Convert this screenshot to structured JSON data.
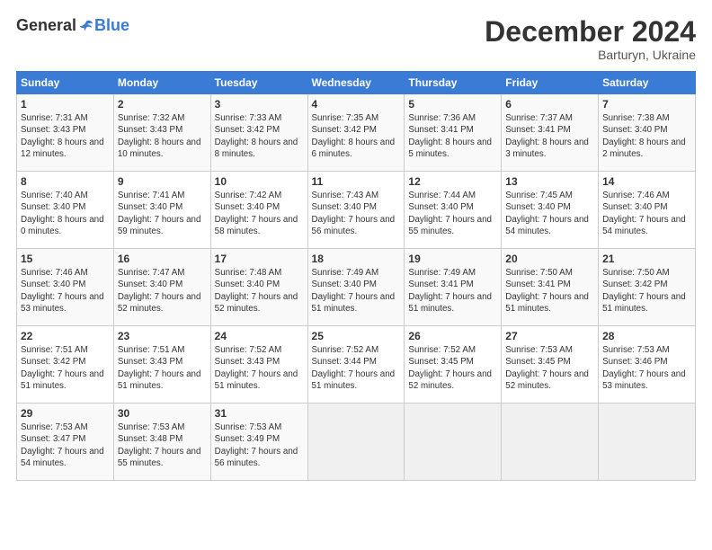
{
  "header": {
    "logo_general": "General",
    "logo_blue": "Blue",
    "title": "December 2024",
    "location": "Barturyn, Ukraine"
  },
  "days_of_week": [
    "Sunday",
    "Monday",
    "Tuesday",
    "Wednesday",
    "Thursday",
    "Friday",
    "Saturday"
  ],
  "weeks": [
    [
      {
        "day": "1",
        "sunrise": "7:31 AM",
        "sunset": "3:43 PM",
        "daylight": "8 hours and 12 minutes."
      },
      {
        "day": "2",
        "sunrise": "7:32 AM",
        "sunset": "3:43 PM",
        "daylight": "8 hours and 10 minutes."
      },
      {
        "day": "3",
        "sunrise": "7:33 AM",
        "sunset": "3:42 PM",
        "daylight": "8 hours and 8 minutes."
      },
      {
        "day": "4",
        "sunrise": "7:35 AM",
        "sunset": "3:42 PM",
        "daylight": "8 hours and 6 minutes."
      },
      {
        "day": "5",
        "sunrise": "7:36 AM",
        "sunset": "3:41 PM",
        "daylight": "8 hours and 5 minutes."
      },
      {
        "day": "6",
        "sunrise": "7:37 AM",
        "sunset": "3:41 PM",
        "daylight": "8 hours and 3 minutes."
      },
      {
        "day": "7",
        "sunrise": "7:38 AM",
        "sunset": "3:40 PM",
        "daylight": "8 hours and 2 minutes."
      }
    ],
    [
      {
        "day": "8",
        "sunrise": "7:40 AM",
        "sunset": "3:40 PM",
        "daylight": "8 hours and 0 minutes."
      },
      {
        "day": "9",
        "sunrise": "7:41 AM",
        "sunset": "3:40 PM",
        "daylight": "7 hours and 59 minutes."
      },
      {
        "day": "10",
        "sunrise": "7:42 AM",
        "sunset": "3:40 PM",
        "daylight": "7 hours and 58 minutes."
      },
      {
        "day": "11",
        "sunrise": "7:43 AM",
        "sunset": "3:40 PM",
        "daylight": "7 hours and 56 minutes."
      },
      {
        "day": "12",
        "sunrise": "7:44 AM",
        "sunset": "3:40 PM",
        "daylight": "7 hours and 55 minutes."
      },
      {
        "day": "13",
        "sunrise": "7:45 AM",
        "sunset": "3:40 PM",
        "daylight": "7 hours and 54 minutes."
      },
      {
        "day": "14",
        "sunrise": "7:46 AM",
        "sunset": "3:40 PM",
        "daylight": "7 hours and 54 minutes."
      }
    ],
    [
      {
        "day": "15",
        "sunrise": "7:46 AM",
        "sunset": "3:40 PM",
        "daylight": "7 hours and 53 minutes."
      },
      {
        "day": "16",
        "sunrise": "7:47 AM",
        "sunset": "3:40 PM",
        "daylight": "7 hours and 52 minutes."
      },
      {
        "day": "17",
        "sunrise": "7:48 AM",
        "sunset": "3:40 PM",
        "daylight": "7 hours and 52 minutes."
      },
      {
        "day": "18",
        "sunrise": "7:49 AM",
        "sunset": "3:40 PM",
        "daylight": "7 hours and 51 minutes."
      },
      {
        "day": "19",
        "sunrise": "7:49 AM",
        "sunset": "3:41 PM",
        "daylight": "7 hours and 51 minutes."
      },
      {
        "day": "20",
        "sunrise": "7:50 AM",
        "sunset": "3:41 PM",
        "daylight": "7 hours and 51 minutes."
      },
      {
        "day": "21",
        "sunrise": "7:50 AM",
        "sunset": "3:42 PM",
        "daylight": "7 hours and 51 minutes."
      }
    ],
    [
      {
        "day": "22",
        "sunrise": "7:51 AM",
        "sunset": "3:42 PM",
        "daylight": "7 hours and 51 minutes."
      },
      {
        "day": "23",
        "sunrise": "7:51 AM",
        "sunset": "3:43 PM",
        "daylight": "7 hours and 51 minutes."
      },
      {
        "day": "24",
        "sunrise": "7:52 AM",
        "sunset": "3:43 PM",
        "daylight": "7 hours and 51 minutes."
      },
      {
        "day": "25",
        "sunrise": "7:52 AM",
        "sunset": "3:44 PM",
        "daylight": "7 hours and 51 minutes."
      },
      {
        "day": "26",
        "sunrise": "7:52 AM",
        "sunset": "3:45 PM",
        "daylight": "7 hours and 52 minutes."
      },
      {
        "day": "27",
        "sunrise": "7:53 AM",
        "sunset": "3:45 PM",
        "daylight": "7 hours and 52 minutes."
      },
      {
        "day": "28",
        "sunrise": "7:53 AM",
        "sunset": "3:46 PM",
        "daylight": "7 hours and 53 minutes."
      }
    ],
    [
      {
        "day": "29",
        "sunrise": "7:53 AM",
        "sunset": "3:47 PM",
        "daylight": "7 hours and 54 minutes."
      },
      {
        "day": "30",
        "sunrise": "7:53 AM",
        "sunset": "3:48 PM",
        "daylight": "7 hours and 55 minutes."
      },
      {
        "day": "31",
        "sunrise": "7:53 AM",
        "sunset": "3:49 PM",
        "daylight": "7 hours and 56 minutes."
      },
      null,
      null,
      null,
      null
    ]
  ]
}
